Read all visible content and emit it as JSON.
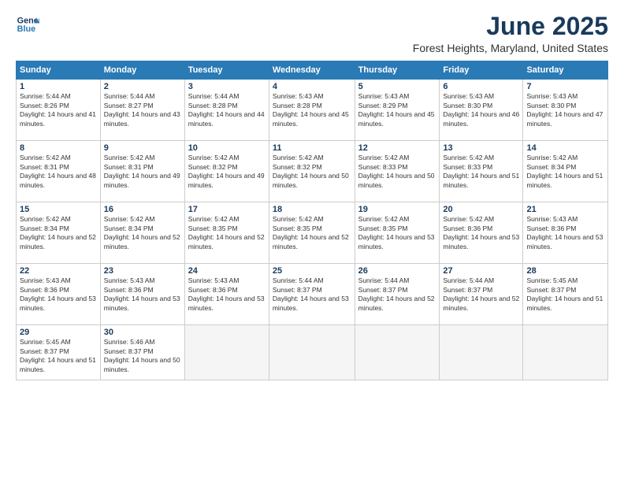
{
  "logo": {
    "line1": "General",
    "line2": "Blue"
  },
  "title": "June 2025",
  "subtitle": "Forest Heights, Maryland, United States",
  "days_of_week": [
    "Sunday",
    "Monday",
    "Tuesday",
    "Wednesday",
    "Thursday",
    "Friday",
    "Saturday"
  ],
  "weeks": [
    [
      {
        "day": 1,
        "sunrise": "5:44 AM",
        "sunset": "8:26 PM",
        "daylight": "14 hours and 41 minutes."
      },
      {
        "day": 2,
        "sunrise": "5:44 AM",
        "sunset": "8:27 PM",
        "daylight": "14 hours and 43 minutes."
      },
      {
        "day": 3,
        "sunrise": "5:44 AM",
        "sunset": "8:28 PM",
        "daylight": "14 hours and 44 minutes."
      },
      {
        "day": 4,
        "sunrise": "5:43 AM",
        "sunset": "8:28 PM",
        "daylight": "14 hours and 45 minutes."
      },
      {
        "day": 5,
        "sunrise": "5:43 AM",
        "sunset": "8:29 PM",
        "daylight": "14 hours and 45 minutes."
      },
      {
        "day": 6,
        "sunrise": "5:43 AM",
        "sunset": "8:30 PM",
        "daylight": "14 hours and 46 minutes."
      },
      {
        "day": 7,
        "sunrise": "5:43 AM",
        "sunset": "8:30 PM",
        "daylight": "14 hours and 47 minutes."
      }
    ],
    [
      {
        "day": 8,
        "sunrise": "5:42 AM",
        "sunset": "8:31 PM",
        "daylight": "14 hours and 48 minutes."
      },
      {
        "day": 9,
        "sunrise": "5:42 AM",
        "sunset": "8:31 PM",
        "daylight": "14 hours and 49 minutes."
      },
      {
        "day": 10,
        "sunrise": "5:42 AM",
        "sunset": "8:32 PM",
        "daylight": "14 hours and 49 minutes."
      },
      {
        "day": 11,
        "sunrise": "5:42 AM",
        "sunset": "8:32 PM",
        "daylight": "14 hours and 50 minutes."
      },
      {
        "day": 12,
        "sunrise": "5:42 AM",
        "sunset": "8:33 PM",
        "daylight": "14 hours and 50 minutes."
      },
      {
        "day": 13,
        "sunrise": "5:42 AM",
        "sunset": "8:33 PM",
        "daylight": "14 hours and 51 minutes."
      },
      {
        "day": 14,
        "sunrise": "5:42 AM",
        "sunset": "8:34 PM",
        "daylight": "14 hours and 51 minutes."
      }
    ],
    [
      {
        "day": 15,
        "sunrise": "5:42 AM",
        "sunset": "8:34 PM",
        "daylight": "14 hours and 52 minutes."
      },
      {
        "day": 16,
        "sunrise": "5:42 AM",
        "sunset": "8:34 PM",
        "daylight": "14 hours and 52 minutes."
      },
      {
        "day": 17,
        "sunrise": "5:42 AM",
        "sunset": "8:35 PM",
        "daylight": "14 hours and 52 minutes."
      },
      {
        "day": 18,
        "sunrise": "5:42 AM",
        "sunset": "8:35 PM",
        "daylight": "14 hours and 52 minutes."
      },
      {
        "day": 19,
        "sunrise": "5:42 AM",
        "sunset": "8:35 PM",
        "daylight": "14 hours and 53 minutes."
      },
      {
        "day": 20,
        "sunrise": "5:42 AM",
        "sunset": "8:36 PM",
        "daylight": "14 hours and 53 minutes."
      },
      {
        "day": 21,
        "sunrise": "5:43 AM",
        "sunset": "8:36 PM",
        "daylight": "14 hours and 53 minutes."
      }
    ],
    [
      {
        "day": 22,
        "sunrise": "5:43 AM",
        "sunset": "8:36 PM",
        "daylight": "14 hours and 53 minutes."
      },
      {
        "day": 23,
        "sunrise": "5:43 AM",
        "sunset": "8:36 PM",
        "daylight": "14 hours and 53 minutes."
      },
      {
        "day": 24,
        "sunrise": "5:43 AM",
        "sunset": "8:36 PM",
        "daylight": "14 hours and 53 minutes."
      },
      {
        "day": 25,
        "sunrise": "5:44 AM",
        "sunset": "8:37 PM",
        "daylight": "14 hours and 53 minutes."
      },
      {
        "day": 26,
        "sunrise": "5:44 AM",
        "sunset": "8:37 PM",
        "daylight": "14 hours and 52 minutes."
      },
      {
        "day": 27,
        "sunrise": "5:44 AM",
        "sunset": "8:37 PM",
        "daylight": "14 hours and 52 minutes."
      },
      {
        "day": 28,
        "sunrise": "5:45 AM",
        "sunset": "8:37 PM",
        "daylight": "14 hours and 51 minutes."
      }
    ],
    [
      {
        "day": 29,
        "sunrise": "5:45 AM",
        "sunset": "8:37 PM",
        "daylight": "14 hours and 51 minutes."
      },
      {
        "day": 30,
        "sunrise": "5:46 AM",
        "sunset": "8:37 PM",
        "daylight": "14 hours and 50 minutes."
      },
      null,
      null,
      null,
      null,
      null
    ]
  ]
}
